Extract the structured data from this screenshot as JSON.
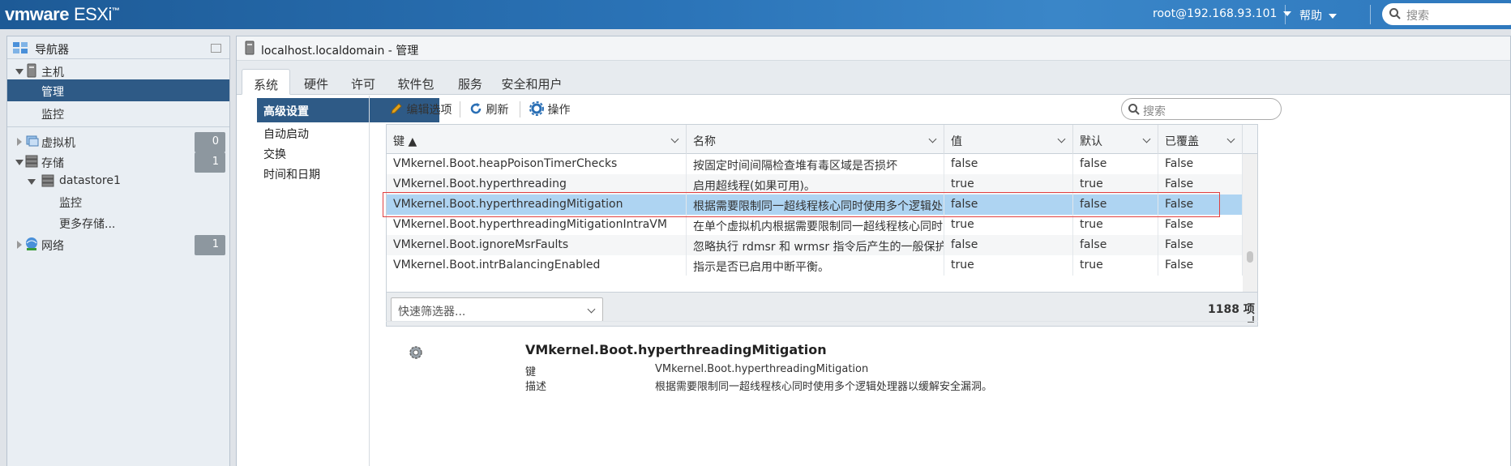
{
  "topbar": {
    "brand_vm": "vmware",
    "brand_product": "ESXi",
    "user": "root@192.168.93.101",
    "help": "帮助",
    "search_placeholder": "搜索"
  },
  "navigator": {
    "title": "导航器",
    "items": [
      {
        "label": "主机"
      },
      {
        "label": "管理"
      },
      {
        "label": "监控"
      },
      {
        "label": "虚拟机",
        "count": "0"
      },
      {
        "label": "存储",
        "count": "1"
      },
      {
        "label": "datastore1"
      },
      {
        "label": "监控"
      },
      {
        "label": "更多存储..."
      },
      {
        "label": "网络",
        "count": "1"
      }
    ]
  },
  "main": {
    "title": "localhost.localdomain - 管理",
    "tabs": [
      {
        "label": "系统"
      },
      {
        "label": "硬件"
      },
      {
        "label": "许可"
      },
      {
        "label": "软件包"
      },
      {
        "label": "服务"
      },
      {
        "label": "安全和用户"
      }
    ],
    "submenu": [
      {
        "label": "高级设置"
      },
      {
        "label": "自动启动"
      },
      {
        "label": "交换"
      },
      {
        "label": "时间和日期"
      }
    ]
  },
  "toolbar": {
    "edit": "编辑选项",
    "refresh": "刷新",
    "actions": "操作",
    "search_placeholder": "搜索"
  },
  "grid": {
    "columns": [
      "键 ▲",
      "名称",
      "值",
      "默认",
      "已覆盖"
    ],
    "rows": [
      {
        "key": "VMkernel.Boot.heapPoisonTimerChecks",
        "name": "按固定时间间隔检查堆有毒区域是否损坏",
        "value": "false",
        "default": "false",
        "overridden": "False"
      },
      {
        "key": "VMkernel.Boot.hyperthreading",
        "name": "启用超线程(如果可用)。",
        "value": "true",
        "default": "true",
        "overridden": "False"
      },
      {
        "key": "VMkernel.Boot.hyperthreadingMitigation",
        "name": "根据需要限制同一超线程核心同时使用多个逻辑处...",
        "value": "false",
        "default": "false",
        "overridden": "False"
      },
      {
        "key": "VMkernel.Boot.hyperthreadingMitigationIntraVM",
        "name": "在单个虚拟机内根据需要限制同一超线程核心同时...",
        "value": "true",
        "default": "true",
        "overridden": "False"
      },
      {
        "key": "VMkernel.Boot.ignoreMsrFaults",
        "name": "忽略执行 rdmsr 和 wrmsr 指令后产生的一般保护故障",
        "value": "false",
        "default": "false",
        "overridden": "False"
      },
      {
        "key": "VMkernel.Boot.intrBalancingEnabled",
        "name": "指示是否已启用中断平衡。",
        "value": "true",
        "default": "true",
        "overridden": "False"
      }
    ],
    "quick_filter": "快速筛选器...",
    "count": "1188 项"
  },
  "detail": {
    "title": "VMkernel.Boot.hyperthreadingMitigation",
    "key_label": "键",
    "key_value": "VMkernel.Boot.hyperthreadingMitigation",
    "desc_label": "描述",
    "desc_value": "根据需要限制同一超线程核心同时使用多个逻辑处理器以缓解安全漏洞。"
  }
}
